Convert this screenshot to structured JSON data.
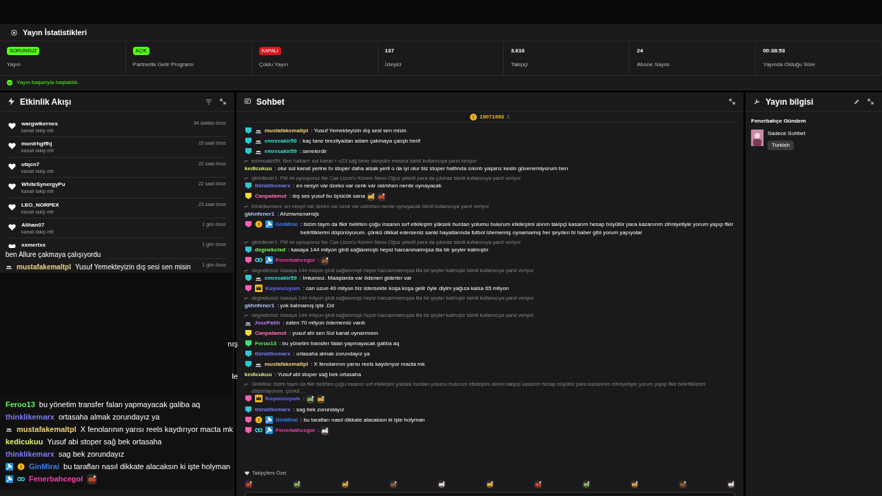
{
  "stats_panel": {
    "title": "Yayın İstatistikleri",
    "cards": [
      {
        "badge": {
          "text": "SORUNSUZ",
          "kind": "ok"
        },
        "label": "Yayın"
      },
      {
        "badge": {
          "text": "AÇIK",
          "kind": "ok"
        },
        "label": "Partnerlik Gelir Programı"
      },
      {
        "badge": {
          "text": "KAPALI",
          "kind": "off"
        },
        "label": "Çoklu Yayın"
      },
      {
        "value": "137",
        "label": "İzleyici"
      },
      {
        "value": "3.616",
        "label": "Takipçi"
      },
      {
        "value": "24",
        "label": "Abone Sayısı"
      },
      {
        "value": "00:38:53",
        "label": "Yayında Olduğu Süre"
      }
    ],
    "status": "Yayın başarıyla başlatıldı."
  },
  "activity_feed": {
    "title": "Etkinlik Akışı",
    "items": [
      {
        "user": "wargwikernes",
        "action": "kanalı takip etti",
        "time": "34 dakika önce"
      },
      {
        "user": "monirhgffhj",
        "action": "kanalı takip etti",
        "time": "15 saat önce"
      },
      {
        "user": "utqcn7",
        "action": "kanalı takip etti",
        "time": "22 saat önce"
      },
      {
        "user": "WhiteSynergyPu",
        "action": "kanalı takip etti",
        "time": "22 saat önce"
      },
      {
        "user": "LEO_NORPEX",
        "action": "kanalı takip etti",
        "time": "23 saat önce"
      },
      {
        "user": "Alihan07",
        "action": "kanalı takip etti",
        "time": "1 gün önce"
      },
      {
        "user": "xxmertxx",
        "time": "1 gün önce"
      },
      {
        "time": "1 gün önce"
      }
    ]
  },
  "stream_overlay": {
    "top_lines": [
      {
        "text": "ben Allure çakmaya çalışıyordu"
      },
      {
        "badges": [
          {
            "kind": "hat"
          }
        ],
        "user": "mustafakemaltpl",
        "color": "#f0d27c",
        "text": "Yusuf Yemekteyizin dış sesi sen misin"
      }
    ],
    "edge_fragments": [
      "nış",
      "le"
    ],
    "lines": [
      {
        "user": "Feroo13",
        "color": "#5cf25c",
        "text": "bu yönetim transfer falan yapmayacak galiba aq"
      },
      {
        "user": "thinklikemarx",
        "color": "#7b7bf0",
        "text": "ortasaha almak zorundayız ya"
      },
      {
        "badges": [
          {
            "kind": "hat"
          }
        ],
        "user": "mustafakemaltpl",
        "color": "#f0d27c",
        "text": "X fenolarının yarısı reels kaydırıyor macta mk"
      },
      {
        "user": "kedicukuu",
        "color": "#d8f07a",
        "text": "Yusuf abi stoper sağ bek ortasaha"
      },
      {
        "user": "thinklikemarx",
        "color": "#7b7bf0",
        "text": "sag bek zorundayız"
      },
      {
        "badges": [
          {
            "kind": "tool"
          },
          {
            "kind": "coin"
          }
        ],
        "user": "GinMirai",
        "color": "#3b7de8",
        "text": "bu tarafları nasıl dikkate alacaksın ki işte holyman"
      },
      {
        "badges": [
          {
            "kind": "tool"
          },
          {
            "kind": "gg"
          }
        ],
        "user": "Fenerbahcegol",
        "color": "#f040a8",
        "emotes": [
          {
            "kind": "picture"
          }
        ]
      }
    ]
  },
  "chat": {
    "title": "Sohbet",
    "gift": {
      "user": "19071993",
      "count": "1"
    },
    "messages": [
      {
        "badges": [
          {
            "kind": "sub",
            "color": "#2ec8d0"
          },
          {
            "kind": "hat"
          }
        ],
        "user": "mustafakemaltpl",
        "color": "#f0d27c",
        "text": ": Yusuf Yemekteyizin dış sesi sen misin"
      },
      {
        "badges": [
          {
            "kind": "sub",
            "color": "#2ec8d0"
          },
          {
            "kind": "hat"
          }
        ],
        "user": "emrecakir59",
        "color": "#2ee6d6",
        "text": ": kaç tane brezilyadan adam çakmaya çalıştı herif"
      },
      {
        "badges": [
          {
            "kind": "sub",
            "color": "#2ec8d0"
          },
          {
            "kind": "hat"
          }
        ],
        "user": "emrecakir59",
        "color": "#2ee6d6",
        "text": ": senelerdir"
      },
      {
        "reply": "emrecakir59: Ben hakan+ sol kanat + u23 sağ beke okeydim mesela isimli kullanıcıya yanıt veriyor",
        "user": "kedicukuu",
        "color": "#d8f07a",
        "text": ": olur sol kanat yerine bı stoper daha alsak yerli o da iyi olur biz stoper hattında sıkıntı yaşarız kesin güvenemiyorum ben"
      },
      {
        "reply": "gkhnfener1: FM mi oynuyoruz Ne Can Uzun'u Kerem Neno Oğuz yeterli para da çıkmaz isimli kullanıcıya yanıt veriyor",
        "badges": [
          {
            "kind": "sub",
            "color": "#2ec8d0"
          }
        ],
        "user": "thinklikemarx",
        "color": "#7b7bf0",
        "text": ": en nesyri var dzeko var cenk var osimhen nerde oynayacak"
      },
      {
        "badges": [
          {
            "kind": "sub",
            "color": "#f2d83a"
          }
        ],
        "user": "Canpalamut",
        "color": "#ff6fb4",
        "text": ": dış ses yusuf bu öpücük sana",
        "emotes": [
          {
            "kind": "picture"
          },
          {
            "kind": "picture"
          }
        ]
      },
      {
        "reply": "thinklikemarx: en nesyri var dzeko var cenk var osimhen nerde oynayacak isimli kullanıcıya yanıt veriyor",
        "user": "gkhnfener1",
        "color": "#b4ccff",
        "text": ": Ahznwnsnwnsjs"
      },
      {
        "badges": [
          {
            "kind": "sub",
            "color": "#ff5fb4"
          },
          {
            "kind": "coin"
          },
          {
            "kind": "tool"
          }
        ],
        "user": "GinMirai",
        "color": "#3b7de8",
        "text": ": bizim taym da fikir belirten çoğu insanın sırf etkileşim yüksek burdan yolumu bulurum etkileşimi alırım takipçi kasarım hesap büyütür para kazanırım zihniyetiyle yorum yapıp fikir belirttiklerini düşünüyorum. çünkü dikkat ederseniz sanki hayatlarında futbol izlememiş oynamamış her şeyden bi haber gibi yorum yapıyolar"
      },
      {
        "reply": "gkhnfener1: FM mi oynuyoruz Ne Can Uzun'u Kerem Neno Oğuz yeterli para da çıkmaz isimli kullanıcıya yanıt veriyor",
        "badges": [
          {
            "kind": "sub",
            "color": "#2ec8d0"
          }
        ],
        "user": "degnekcixd",
        "color": "#7cff5a",
        "text": ": kasaya 144 milyon girdi sağlanmıştı hepsi harcanmamışsa illa bir şeyler kalmıştır"
      },
      {
        "badges": [
          {
            "kind": "sub",
            "color": "#ff5fb4"
          },
          {
            "kind": "gg"
          },
          {
            "kind": "tool"
          }
        ],
        "user": "Fenerbahcegol",
        "color": "#f040a8",
        "text": ":",
        "emotes": [
          {
            "kind": "picture"
          }
        ]
      },
      {
        "reply": "degnekcixd: kasaya 144 milyon girdi sağlanmıştı hepsi harcanmamışsa illa bir şeyler kalmıştır isimli kullanıcıya yanıt veriyor",
        "badges": [
          {
            "kind": "sub",
            "color": "#2ec8d0"
          },
          {
            "kind": "hat"
          }
        ],
        "user": "emrecakir59",
        "color": "#2ee6d6",
        "text": ": İmkansız. Maaşlarda var ödenen giderler var"
      },
      {
        "badges": [
          {
            "kind": "sub",
            "color": "#ff5fb4"
          },
          {
            "kind": "crown"
          }
        ],
        "user": "Koyuncuyum",
        "color": "#6b6bff",
        "text": ": can uzun 40 milyon biz istersekte koşa koşa gelir öyle diyim yağıza kalsa 65 milyon"
      },
      {
        "reply": "degnekcixd: kasaya 144 milyon girdi sağlanmıştı hepsi harcanmamışsa illa bir şeyler kalmıştır isimli kullanıcıya yanıt veriyor",
        "user": "gkhnfener1",
        "color": "#b4ccff",
        "text": ": yok kalmamış işte .Dd"
      },
      {
        "reply": "degnekcixd: kasaya 144 milyon girdi sağlanmıştı hepsi harcanmamışsa illa bir şeyler kalmıştır isimli kullanıcıya yanıt veriyor",
        "badges": [
          {
            "kind": "hat"
          }
        ],
        "user": "JoseFatih",
        "color": "#b87bff",
        "text": ": zaten 70 milyon ödememiz vardı"
      },
      {
        "badges": [
          {
            "kind": "sub",
            "color": "#f2d83a"
          }
        ],
        "user": "Canpalamut",
        "color": "#ff6fb4",
        "text": ": yusuf abi sen Sol kanat oynarmısın"
      },
      {
        "badges": [
          {
            "kind": "sub",
            "color": "#3ee07a"
          }
        ],
        "user": "Feroo13",
        "color": "#5cf25c",
        "text": ": bu yönetim transfer falan yapmayacak galiba aq"
      },
      {
        "badges": [
          {
            "kind": "sub",
            "color": "#2ec8d0"
          }
        ],
        "user": "thinklikemarx",
        "color": "#7b7bf0",
        "text": ": ortasaha almak zorundayız ya"
      },
      {
        "badges": [
          {
            "kind": "sub",
            "color": "#2ec8d0"
          },
          {
            "kind": "hat"
          }
        ],
        "user": "mustafakemaltpl",
        "color": "#f0d27c",
        "text": ": X fenolarının yarısı reels kaydırıyor macta mk"
      },
      {
        "user": "kedicukuu",
        "color": "#d8f07a",
        "text": ": Yusuf abi stoper sağ bek ortasaha"
      },
      {
        "reply": "GinMirai: bizim taym da fikir belirten çoğu insanın sırf etkileşim yüksek burdan yolumu bulurum etkileşimi alırım takipçi kasarım hesap büyütür para kazanırım zihniyetiyle yorum yapıp fikir belirttiklerini düşünüyorum. çünkü ...",
        "badges": [
          {
            "kind": "sub",
            "color": "#ff5fb4"
          },
          {
            "kind": "crown"
          }
        ],
        "user": "Koyuncuyum",
        "color": "#6b6bff",
        "text": ":",
        "emotes": [
          {
            "kind": "picture"
          },
          {
            "kind": "picture"
          }
        ]
      },
      {
        "badges": [
          {
            "kind": "sub",
            "color": "#2ec8d0"
          }
        ],
        "user": "thinklikemarx",
        "color": "#7b7bf0",
        "text": ": sag bek zorundayız"
      },
      {
        "badges": [
          {
            "kind": "sub",
            "color": "#ff5fb4"
          },
          {
            "kind": "coin"
          },
          {
            "kind": "tool"
          }
        ],
        "user": "GinMirai",
        "color": "#3b7de8",
        "text": ": bu tarafları nasıl dikkate alacaksın ki işte holyman"
      },
      {
        "badges": [
          {
            "kind": "sub",
            "color": "#ff5fb4"
          },
          {
            "kind": "gg"
          },
          {
            "kind": "tool"
          }
        ],
        "user": "Fenerbahcegol",
        "color": "#f040a8",
        "text": ":",
        "emotes": [
          {
            "kind": "picture"
          }
        ]
      }
    ],
    "followers_only": "Takipçilere Özel",
    "emote_bar": [
      {
        "kind": "picture"
      },
      {
        "kind": "picture"
      },
      {
        "kind": "picture"
      },
      {
        "kind": "picture"
      },
      {
        "kind": "picture"
      },
      {
        "kind": "picture"
      },
      {
        "kind": "picture"
      },
      {
        "kind": "picture"
      },
      {
        "kind": "picture"
      },
      {
        "kind": "picture"
      },
      {
        "kind": "picture"
      }
    ]
  },
  "stream_info": {
    "title": "Yayın bilgisi",
    "stream_title": "Fenerbahçe Gündem",
    "category": "Sadece Sohbet",
    "tags": [
      "Turkish"
    ]
  }
}
